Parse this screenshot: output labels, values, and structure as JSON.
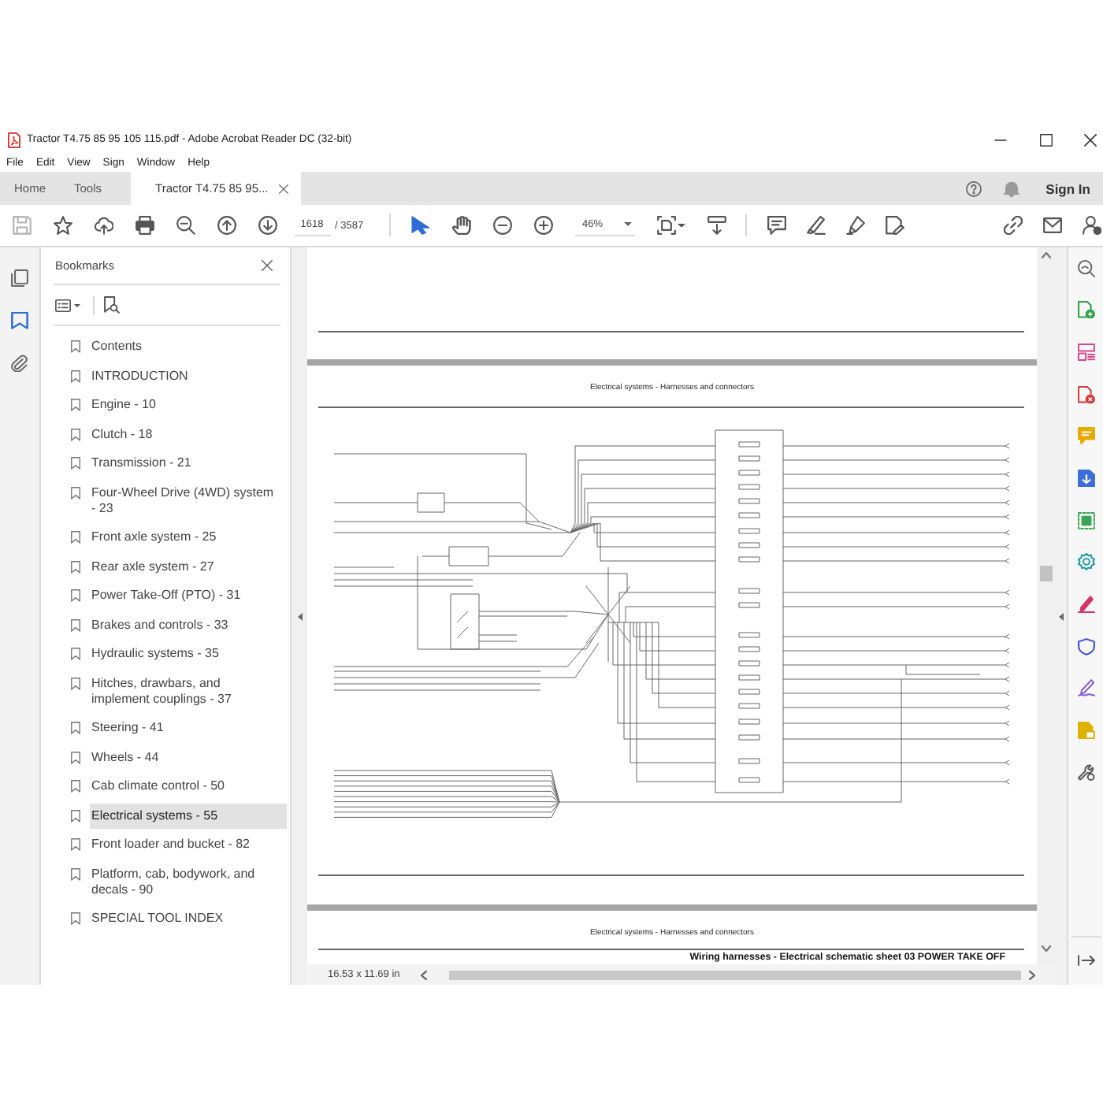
{
  "window": {
    "title": "Tractor T4.75 85 95 105 115.pdf - Adobe Acrobat Reader DC (32-bit)"
  },
  "menu": [
    "File",
    "Edit",
    "View",
    "Sign",
    "Window",
    "Help"
  ],
  "tabs": [
    {
      "label": "Home",
      "selected": false,
      "closable": false
    },
    {
      "label": "Tools",
      "selected": false,
      "closable": false
    },
    {
      "label": "Tractor T4.75 85 95...",
      "selected": true,
      "closable": true
    }
  ],
  "account": {
    "sign_in": "Sign In"
  },
  "toolbar": {
    "page": "1618",
    "page_count": "/ 3587",
    "zoom": "46%"
  },
  "left_rail": [
    {
      "kind": "pages",
      "selected": false
    },
    {
      "kind": "bookmarks",
      "selected": true
    },
    {
      "kind": "attachments",
      "selected": false
    }
  ],
  "bookmarks": {
    "title": "Bookmarks",
    "items": [
      {
        "label": "Contents",
        "selected": false
      },
      {
        "label": "INTRODUCTION",
        "selected": false
      },
      {
        "label": "Engine - 10",
        "selected": false
      },
      {
        "label": "Clutch - 18",
        "selected": false
      },
      {
        "label": "Transmission - 21",
        "selected": false
      },
      {
        "label": "Four-Wheel Drive (4WD) system - 23",
        "selected": false
      },
      {
        "label": "Front axle system - 25",
        "selected": false
      },
      {
        "label": "Rear axle system - 27",
        "selected": false
      },
      {
        "label": "Power Take-Off (PTO) - 31",
        "selected": false
      },
      {
        "label": "Brakes and controls - 33",
        "selected": false
      },
      {
        "label": "Hydraulic systems - 35",
        "selected": false
      },
      {
        "label": "Hitches, drawbars, and implement couplings - 37",
        "selected": false
      },
      {
        "label": "Steering - 41",
        "selected": false
      },
      {
        "label": "Wheels - 44",
        "selected": false
      },
      {
        "label": "Cab climate control - 50",
        "selected": false
      },
      {
        "label": "Electrical systems - 55",
        "selected": true
      },
      {
        "label": "Front loader and bucket - 82",
        "selected": false
      },
      {
        "label": "Platform, cab, bodywork, and decals - 90",
        "selected": false
      },
      {
        "label": "SPECIAL TOOL INDEX",
        "selected": false
      }
    ]
  },
  "document": {
    "pages": [
      {
        "kind": "page_end"
      },
      {
        "kind": "schematic",
        "header": "Electrical systems - Harnesses and connectors"
      },
      {
        "kind": "page_start",
        "header": "Electrical systems - Harnesses and connectors",
        "title": "Wiring harnesses - Electrical schematic sheet 03 POWER TAKE OFF"
      }
    ]
  },
  "status_bar": {
    "page_size": "16.53 x 11.69 in"
  }
}
